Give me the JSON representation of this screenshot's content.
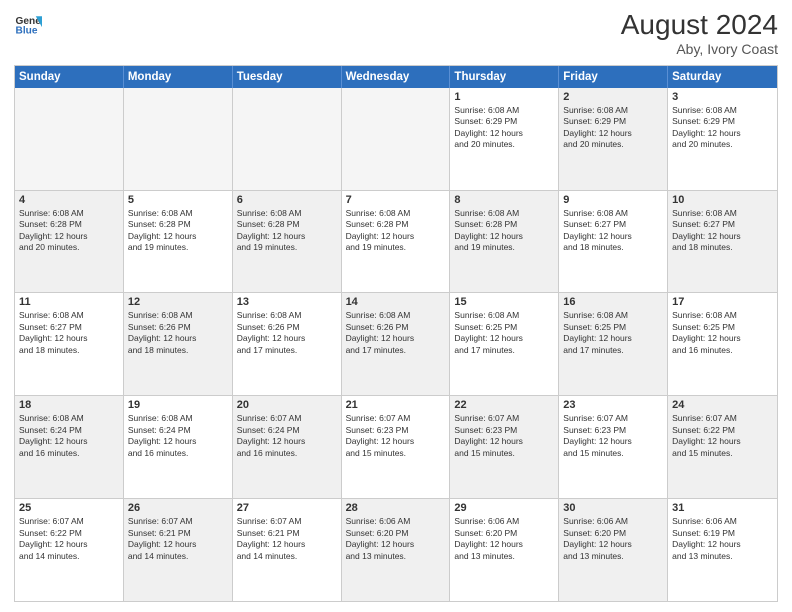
{
  "logo": {
    "line1": "General",
    "line2": "Blue"
  },
  "title": "August 2024",
  "subtitle": "Aby, Ivory Coast",
  "days": [
    "Sunday",
    "Monday",
    "Tuesday",
    "Wednesday",
    "Thursday",
    "Friday",
    "Saturday"
  ],
  "rows": [
    [
      {
        "day": "",
        "info": "",
        "shade": "empty"
      },
      {
        "day": "",
        "info": "",
        "shade": "empty"
      },
      {
        "day": "",
        "info": "",
        "shade": "empty"
      },
      {
        "day": "",
        "info": "",
        "shade": "empty"
      },
      {
        "day": "1",
        "info": "Sunrise: 6:08 AM\nSunset: 6:29 PM\nDaylight: 12 hours\nand 20 minutes.",
        "shade": ""
      },
      {
        "day": "2",
        "info": "Sunrise: 6:08 AM\nSunset: 6:29 PM\nDaylight: 12 hours\nand 20 minutes.",
        "shade": "shaded"
      },
      {
        "day": "3",
        "info": "Sunrise: 6:08 AM\nSunset: 6:29 PM\nDaylight: 12 hours\nand 20 minutes.",
        "shade": ""
      }
    ],
    [
      {
        "day": "4",
        "info": "Sunrise: 6:08 AM\nSunset: 6:28 PM\nDaylight: 12 hours\nand 20 minutes.",
        "shade": "shaded"
      },
      {
        "day": "5",
        "info": "Sunrise: 6:08 AM\nSunset: 6:28 PM\nDaylight: 12 hours\nand 19 minutes.",
        "shade": ""
      },
      {
        "day": "6",
        "info": "Sunrise: 6:08 AM\nSunset: 6:28 PM\nDaylight: 12 hours\nand 19 minutes.",
        "shade": "shaded"
      },
      {
        "day": "7",
        "info": "Sunrise: 6:08 AM\nSunset: 6:28 PM\nDaylight: 12 hours\nand 19 minutes.",
        "shade": ""
      },
      {
        "day": "8",
        "info": "Sunrise: 6:08 AM\nSunset: 6:28 PM\nDaylight: 12 hours\nand 19 minutes.",
        "shade": "shaded"
      },
      {
        "day": "9",
        "info": "Sunrise: 6:08 AM\nSunset: 6:27 PM\nDaylight: 12 hours\nand 18 minutes.",
        "shade": ""
      },
      {
        "day": "10",
        "info": "Sunrise: 6:08 AM\nSunset: 6:27 PM\nDaylight: 12 hours\nand 18 minutes.",
        "shade": "shaded"
      }
    ],
    [
      {
        "day": "11",
        "info": "Sunrise: 6:08 AM\nSunset: 6:27 PM\nDaylight: 12 hours\nand 18 minutes.",
        "shade": ""
      },
      {
        "day": "12",
        "info": "Sunrise: 6:08 AM\nSunset: 6:26 PM\nDaylight: 12 hours\nand 18 minutes.",
        "shade": "shaded"
      },
      {
        "day": "13",
        "info": "Sunrise: 6:08 AM\nSunset: 6:26 PM\nDaylight: 12 hours\nand 17 minutes.",
        "shade": ""
      },
      {
        "day": "14",
        "info": "Sunrise: 6:08 AM\nSunset: 6:26 PM\nDaylight: 12 hours\nand 17 minutes.",
        "shade": "shaded"
      },
      {
        "day": "15",
        "info": "Sunrise: 6:08 AM\nSunset: 6:25 PM\nDaylight: 12 hours\nand 17 minutes.",
        "shade": ""
      },
      {
        "day": "16",
        "info": "Sunrise: 6:08 AM\nSunset: 6:25 PM\nDaylight: 12 hours\nand 17 minutes.",
        "shade": "shaded"
      },
      {
        "day": "17",
        "info": "Sunrise: 6:08 AM\nSunset: 6:25 PM\nDaylight: 12 hours\nand 16 minutes.",
        "shade": ""
      }
    ],
    [
      {
        "day": "18",
        "info": "Sunrise: 6:08 AM\nSunset: 6:24 PM\nDaylight: 12 hours\nand 16 minutes.",
        "shade": "shaded"
      },
      {
        "day": "19",
        "info": "Sunrise: 6:08 AM\nSunset: 6:24 PM\nDaylight: 12 hours\nand 16 minutes.",
        "shade": ""
      },
      {
        "day": "20",
        "info": "Sunrise: 6:07 AM\nSunset: 6:24 PM\nDaylight: 12 hours\nand 16 minutes.",
        "shade": "shaded"
      },
      {
        "day": "21",
        "info": "Sunrise: 6:07 AM\nSunset: 6:23 PM\nDaylight: 12 hours\nand 15 minutes.",
        "shade": ""
      },
      {
        "day": "22",
        "info": "Sunrise: 6:07 AM\nSunset: 6:23 PM\nDaylight: 12 hours\nand 15 minutes.",
        "shade": "shaded"
      },
      {
        "day": "23",
        "info": "Sunrise: 6:07 AM\nSunset: 6:23 PM\nDaylight: 12 hours\nand 15 minutes.",
        "shade": ""
      },
      {
        "day": "24",
        "info": "Sunrise: 6:07 AM\nSunset: 6:22 PM\nDaylight: 12 hours\nand 15 minutes.",
        "shade": "shaded"
      }
    ],
    [
      {
        "day": "25",
        "info": "Sunrise: 6:07 AM\nSunset: 6:22 PM\nDaylight: 12 hours\nand 14 minutes.",
        "shade": ""
      },
      {
        "day": "26",
        "info": "Sunrise: 6:07 AM\nSunset: 6:21 PM\nDaylight: 12 hours\nand 14 minutes.",
        "shade": "shaded"
      },
      {
        "day": "27",
        "info": "Sunrise: 6:07 AM\nSunset: 6:21 PM\nDaylight: 12 hours\nand 14 minutes.",
        "shade": ""
      },
      {
        "day": "28",
        "info": "Sunrise: 6:06 AM\nSunset: 6:20 PM\nDaylight: 12 hours\nand 13 minutes.",
        "shade": "shaded"
      },
      {
        "day": "29",
        "info": "Sunrise: 6:06 AM\nSunset: 6:20 PM\nDaylight: 12 hours\nand 13 minutes.",
        "shade": ""
      },
      {
        "day": "30",
        "info": "Sunrise: 6:06 AM\nSunset: 6:20 PM\nDaylight: 12 hours\nand 13 minutes.",
        "shade": "shaded"
      },
      {
        "day": "31",
        "info": "Sunrise: 6:06 AM\nSunset: 6:19 PM\nDaylight: 12 hours\nand 13 minutes.",
        "shade": ""
      }
    ]
  ]
}
